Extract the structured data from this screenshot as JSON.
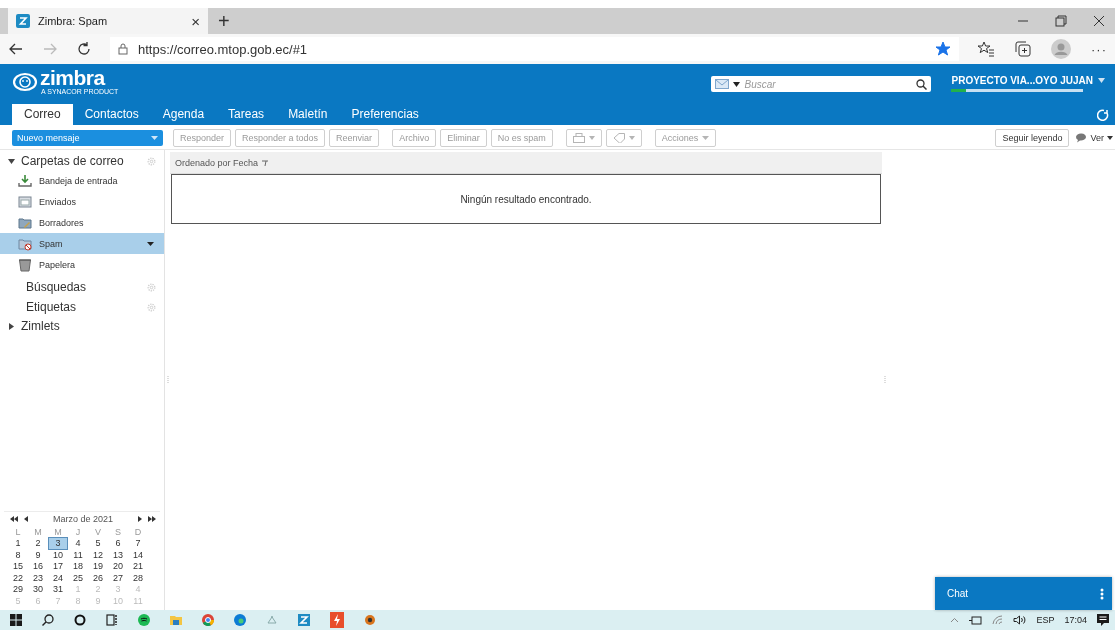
{
  "browser": {
    "tab": {
      "title": "Zimbra: Spam",
      "close": "×"
    },
    "new_tab": "+",
    "url": "https://correo.mtop.gob.ec/#1",
    "favorite": true,
    "menu": "···"
  },
  "logo": {
    "name": "zimbra",
    "tagline": "A SYNACOR PRODUCT"
  },
  "search": {
    "placeholder": "Buscar"
  },
  "user": {
    "name": "PROYECTO VIA...OYO JUJAN",
    "level": 0.11
  },
  "app_tabs": [
    {
      "label": "Correo",
      "selected": true
    },
    {
      "label": "Contactos",
      "selected": false
    },
    {
      "label": "Agenda",
      "selected": false
    },
    {
      "label": "Tareas",
      "selected": false
    },
    {
      "label": "Maletín",
      "selected": false
    },
    {
      "label": "Preferencias",
      "selected": false
    }
  ],
  "new_message": "Nuevo mensaje",
  "toolbar": [
    {
      "kind": "button",
      "label": "Responder",
      "disabled": true
    },
    {
      "kind": "button",
      "label": "Responder a todos",
      "disabled": true
    },
    {
      "kind": "button",
      "label": "Reenviar",
      "disabled": true
    },
    {
      "kind": "gap"
    },
    {
      "kind": "button",
      "label": "Archivo",
      "disabled": true
    },
    {
      "kind": "button",
      "label": "Eliminar",
      "disabled": true
    },
    {
      "kind": "button",
      "label": "No es spam",
      "disabled": true
    },
    {
      "kind": "gap"
    },
    {
      "kind": "printer-menu",
      "disabled": true
    },
    {
      "kind": "tag-menu",
      "disabled": true
    },
    {
      "kind": "gap"
    },
    {
      "kind": "menu",
      "label": "Acciones",
      "disabled": true
    }
  ],
  "reading": {
    "continue": "Seguir leyendo",
    "view": "Ver"
  },
  "folders": {
    "label": "Carpetas de correo",
    "expanded": true,
    "items": [
      {
        "kind": "inbox",
        "label": "Bandeja de entrada",
        "selected": false
      },
      {
        "kind": "sent",
        "label": "Enviados",
        "selected": false
      },
      {
        "kind": "drafts",
        "label": "Borradores",
        "selected": false
      },
      {
        "kind": "spam",
        "label": "Spam",
        "selected": true
      },
      {
        "kind": "trash",
        "label": "Papelera",
        "selected": false
      }
    ]
  },
  "sections": [
    {
      "label": "Búsquedas"
    },
    {
      "label": "Etiquetas"
    }
  ],
  "zimlets": {
    "label": "Zimlets",
    "expanded": false
  },
  "calendar": {
    "title": "Marzo de 2021",
    "weekdays": [
      "L",
      "M",
      "M",
      "J",
      "V",
      "S",
      "D"
    ],
    "weeks": [
      [
        {
          "day": "1",
          "muted": false,
          "selected": false
        },
        {
          "day": "2",
          "muted": false,
          "selected": false
        },
        {
          "day": "3",
          "muted": false,
          "selected": true
        },
        {
          "day": "4",
          "muted": false,
          "selected": false
        },
        {
          "day": "5",
          "muted": false,
          "selected": false
        },
        {
          "day": "6",
          "muted": false,
          "selected": false
        },
        {
          "day": "7",
          "muted": false,
          "selected": false
        }
      ],
      [
        {
          "day": "8",
          "muted": false,
          "selected": false
        },
        {
          "day": "9",
          "muted": false,
          "selected": false
        },
        {
          "day": "10",
          "muted": false,
          "selected": false
        },
        {
          "day": "11",
          "muted": false,
          "selected": false
        },
        {
          "day": "12",
          "muted": false,
          "selected": false
        },
        {
          "day": "13",
          "muted": false,
          "selected": false
        },
        {
          "day": "14",
          "muted": false,
          "selected": false
        }
      ],
      [
        {
          "day": "15",
          "muted": false,
          "selected": false
        },
        {
          "day": "16",
          "muted": false,
          "selected": false
        },
        {
          "day": "17",
          "muted": false,
          "selected": false
        },
        {
          "day": "18",
          "muted": false,
          "selected": false
        },
        {
          "day": "19",
          "muted": false,
          "selected": false
        },
        {
          "day": "20",
          "muted": false,
          "selected": false
        },
        {
          "day": "21",
          "muted": false,
          "selected": false
        }
      ],
      [
        {
          "day": "22",
          "muted": false,
          "selected": false
        },
        {
          "day": "23",
          "muted": false,
          "selected": false
        },
        {
          "day": "24",
          "muted": false,
          "selected": false
        },
        {
          "day": "25",
          "muted": false,
          "selected": false
        },
        {
          "day": "26",
          "muted": false,
          "selected": false
        },
        {
          "day": "27",
          "muted": false,
          "selected": false
        },
        {
          "day": "28",
          "muted": false,
          "selected": false
        }
      ],
      [
        {
          "day": "29",
          "muted": false,
          "selected": false
        },
        {
          "day": "30",
          "muted": false,
          "selected": false
        },
        {
          "day": "31",
          "muted": false,
          "selected": false
        },
        {
          "day": "1",
          "muted": true,
          "selected": false
        },
        {
          "day": "2",
          "muted": true,
          "selected": false
        },
        {
          "day": "3",
          "muted": true,
          "selected": false
        },
        {
          "day": "4",
          "muted": true,
          "selected": false
        }
      ],
      [
        {
          "day": "5",
          "muted": true,
          "selected": false
        },
        {
          "day": "6",
          "muted": true,
          "selected": false
        },
        {
          "day": "7",
          "muted": true,
          "selected": false
        },
        {
          "day": "8",
          "muted": true,
          "selected": false
        },
        {
          "day": "9",
          "muted": true,
          "selected": false
        },
        {
          "day": "10",
          "muted": true,
          "selected": false
        },
        {
          "day": "11",
          "muted": true,
          "selected": false
        }
      ]
    ]
  },
  "list": {
    "sort_label": "Ordenado por Fecha",
    "empty": "Ningún resultado encontrado."
  },
  "chat": {
    "title": "Chat"
  },
  "tray": {
    "language": "ESP",
    "time": "17:04"
  }
}
